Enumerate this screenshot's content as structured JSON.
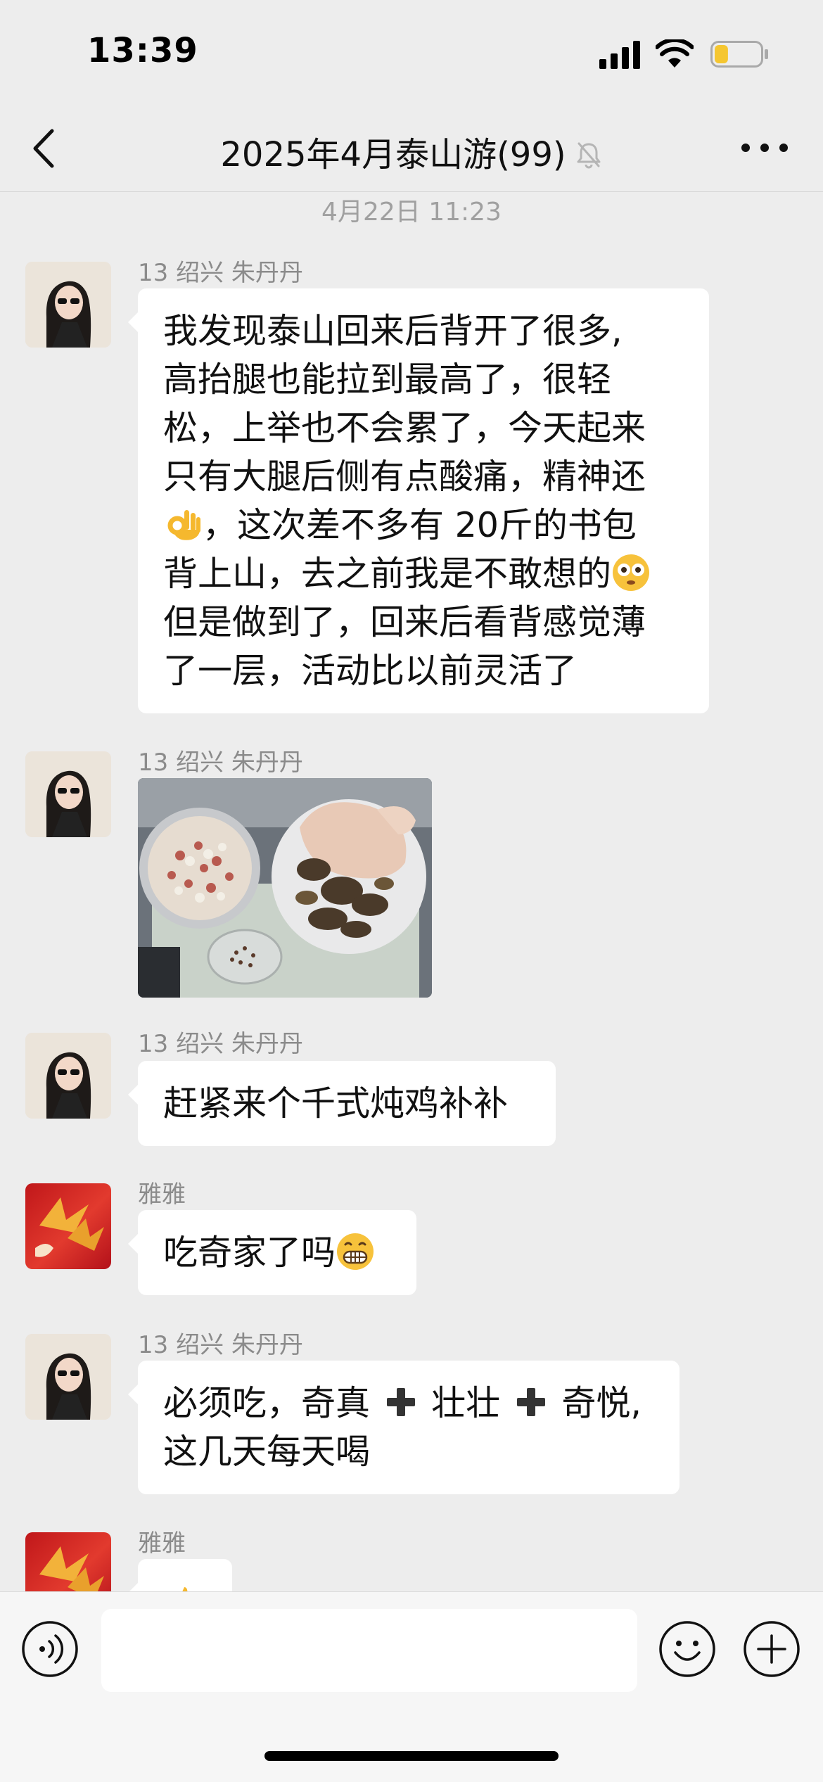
{
  "status_bar": {
    "time": "13:39",
    "battery_level": 0.3
  },
  "header": {
    "title": "2025年4月泰山游(99)",
    "muted": true
  },
  "chat": {
    "timestamp": "4月22日 11:23",
    "messages": [
      {
        "sender": "13 绍兴 朱丹丹",
        "type": "text",
        "lines": [
          "我发现泰山回来后背开了很多,",
          "高抬腿也能拉到最高了，很轻",
          "松，上举也不会累了，今天起来",
          "只有大腿后侧有点酸痛，精神还"
        ],
        "line5_text": "，这次差不多有 20斤的书包",
        "line6_text": "背上山，去之前我是不敢想的",
        "lines_tail": [
          "但是做到了，回来后看背感觉薄",
          "了一层，活动比以前灵活了"
        ]
      },
      {
        "sender": "13 绍兴 朱丹丹",
        "type": "image"
      },
      {
        "sender": "13 绍兴 朱丹丹",
        "type": "text",
        "text": "赶紧来个千式炖鸡补补"
      },
      {
        "sender": "雅雅",
        "type": "text",
        "text": "吃奇家了吗"
      },
      {
        "sender": "13 绍兴 朱丹丹",
        "type": "text",
        "line1_a": "必须吃，奇真",
        "line1_b": "壮壮",
        "line1_c": "奇悦,",
        "line2": "这几天每天喝"
      },
      {
        "sender": "雅雅",
        "type": "partial"
      }
    ]
  },
  "input_bar": {
    "placeholder": ""
  },
  "colors": {
    "background": "#ededed",
    "bubble": "#ffffff",
    "timestamp": "#a0a0a0"
  },
  "icons": [
    "back-icon",
    "mute-bell-icon",
    "more-icon",
    "voice-icon",
    "emoji-icon",
    "plus-icon"
  ]
}
